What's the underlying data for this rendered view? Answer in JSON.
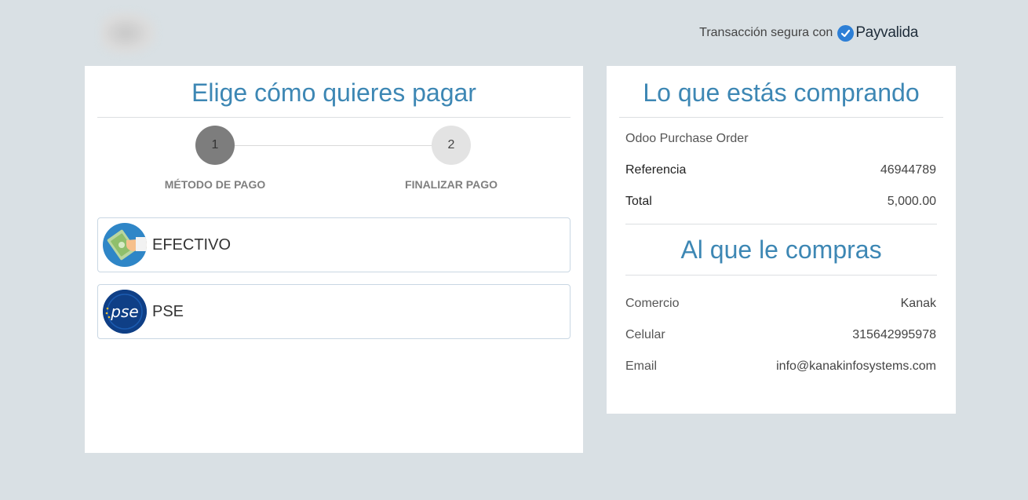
{
  "header": {
    "secure_text": "Transacción segura con",
    "brand": "Payvalida"
  },
  "left": {
    "title": "Elige cómo quieres pagar",
    "steps": [
      {
        "number": "1",
        "label": "MÉTODO DE PAGO"
      },
      {
        "number": "2",
        "label": "FINALIZAR PAGO"
      }
    ],
    "methods": [
      {
        "label": "EFECTIVO",
        "icon": "cash-hand-icon"
      },
      {
        "label": "PSE",
        "icon": "pse-logo-icon"
      }
    ]
  },
  "right": {
    "title": "Lo que estás comprando",
    "product": "Odoo Purchase Order",
    "reference_label": "Referencia",
    "reference_value": "46944789",
    "total_label": "Total",
    "total_value": "5,000.00",
    "merchant_title": "Al que le compras",
    "merchant_rows": [
      {
        "label": "Comercio",
        "value": "Kanak"
      },
      {
        "label": "Celular",
        "value": "315642995978"
      },
      {
        "label": "Email",
        "value": "info@kanakinfosystems.com"
      }
    ]
  },
  "colors": {
    "accent": "#3d87b4",
    "background": "#d9e0e4",
    "step_active": "#7d7d7d",
    "step_inactive": "#e3e3e3"
  }
}
